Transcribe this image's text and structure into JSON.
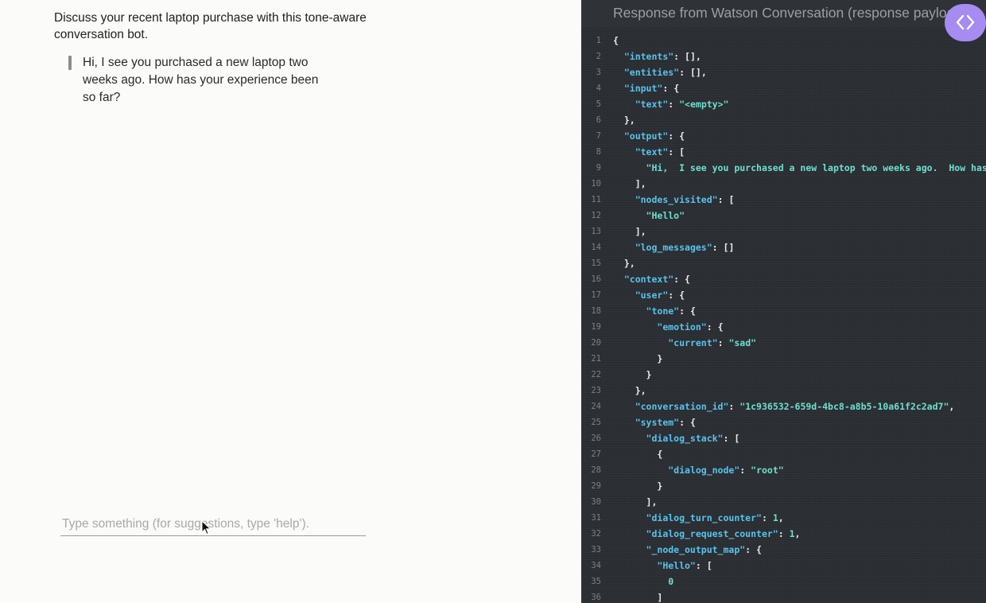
{
  "chat": {
    "intro": "Discuss your recent laptop purchase with this tone-aware conversation bot.",
    "bot_message": "Hi, I see you purchased a new laptop two weeks ago. How has your experience been so far?",
    "input_placeholder": "Type something (for suggestions, type 'help').",
    "input_value": ""
  },
  "json_panel": {
    "title": "Response from Watson Conversation (response payload)",
    "toggle_icon": "code-brackets-icon",
    "lines": [
      {
        "n": 1,
        "code": "{"
      },
      {
        "n": 2,
        "code": "  \"intents\": [],"
      },
      {
        "n": 3,
        "code": "  \"entities\": [],"
      },
      {
        "n": 4,
        "code": "  \"input\": {"
      },
      {
        "n": 5,
        "code": "    \"text\": \"<empty>\""
      },
      {
        "n": 6,
        "code": "  },"
      },
      {
        "n": 7,
        "code": "  \"output\": {"
      },
      {
        "n": 8,
        "code": "    \"text\": ["
      },
      {
        "n": 9,
        "code": "      \"Hi,  I see you purchased a new laptop two weeks ago.  How has your experience been so far?\""
      },
      {
        "n": 10,
        "code": "    ],"
      },
      {
        "n": 11,
        "code": "    \"nodes_visited\": ["
      },
      {
        "n": 12,
        "code": "      \"Hello\""
      },
      {
        "n": 13,
        "code": "    ],"
      },
      {
        "n": 14,
        "code": "    \"log_messages\": []"
      },
      {
        "n": 15,
        "code": "  },"
      },
      {
        "n": 16,
        "code": "  \"context\": {"
      },
      {
        "n": 17,
        "code": "    \"user\": {"
      },
      {
        "n": 18,
        "code": "      \"tone\": {"
      },
      {
        "n": 19,
        "code": "        \"emotion\": {"
      },
      {
        "n": 20,
        "code": "          \"current\": \"sad\""
      },
      {
        "n": 21,
        "code": "        }"
      },
      {
        "n": 22,
        "code": "      }"
      },
      {
        "n": 23,
        "code": "    },"
      },
      {
        "n": 24,
        "code": "    \"conversation_id\": \"1c936532-659d-4bc8-a8b5-10a61f2c2ad7\","
      },
      {
        "n": 25,
        "code": "    \"system\": {"
      },
      {
        "n": 26,
        "code": "      \"dialog_stack\": ["
      },
      {
        "n": 27,
        "code": "        {"
      },
      {
        "n": 28,
        "code": "          \"dialog_node\": \"root\""
      },
      {
        "n": 29,
        "code": "        }"
      },
      {
        "n": 30,
        "code": "      ],"
      },
      {
        "n": 31,
        "code": "      \"dialog_turn_counter\": 1,"
      },
      {
        "n": 32,
        "code": "      \"dialog_request_counter\": 1,"
      },
      {
        "n": 33,
        "code": "      \"_node_output_map\": {"
      },
      {
        "n": 34,
        "code": "        \"Hello\": ["
      },
      {
        "n": 35,
        "code": "          0"
      },
      {
        "n": 36,
        "code": "        ]"
      }
    ]
  },
  "colors": {
    "json_key": "#58c4ee",
    "json_string": "#6de0ce",
    "toggle_accent": "#a68bf1",
    "panel_bg": "#2b2e33"
  }
}
